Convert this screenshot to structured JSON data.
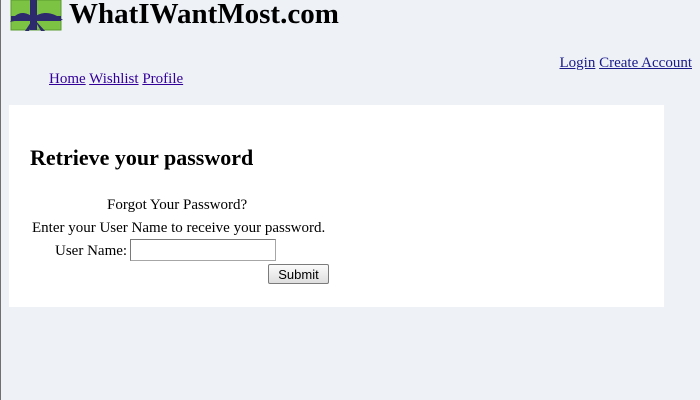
{
  "site": {
    "title": "WhatIWantMost.com",
    "logo_icon": "gift-box-icon"
  },
  "nav": {
    "items": [
      {
        "label": "Home"
      },
      {
        "label": "Wishlist"
      },
      {
        "label": "Profile"
      }
    ]
  },
  "account": {
    "login_label": "Login",
    "create_account_label": "Create Account"
  },
  "page": {
    "title": "Retrieve your password"
  },
  "form": {
    "heading": "Forgot Your Password?",
    "instructions": "Enter your User Name to receive your password.",
    "username_label": "User Name:",
    "username_value": "",
    "submit_label": "Submit"
  },
  "colors": {
    "page_background": "#eef2f7",
    "panel_background": "#ffffff",
    "link": "#330099",
    "logo_green": "#7cc243",
    "logo_ribbon": "#2d2a6e"
  }
}
